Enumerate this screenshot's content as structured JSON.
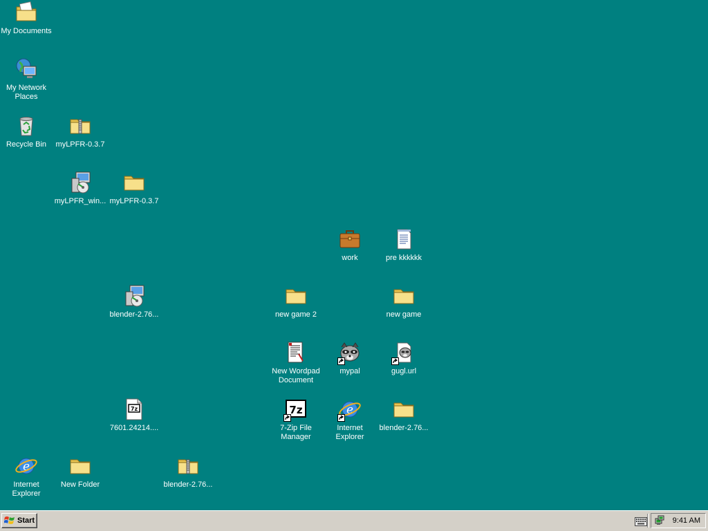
{
  "desktop": {
    "background": "#008080",
    "icons": [
      {
        "label": "My Documents",
        "icon": "my-documents-icon"
      },
      {
        "label": "My Network Places",
        "icon": "network-places-icon"
      },
      {
        "label": "Recycle Bin",
        "icon": "recycle-bin-icon"
      },
      {
        "label": "myLPFR-0.3.7",
        "icon": "zip-folder-icon"
      },
      {
        "label": "myLPFR_win...",
        "icon": "installer-icon"
      },
      {
        "label": "myLPFR-0.3.7",
        "icon": "folder-icon"
      },
      {
        "label": "work",
        "icon": "briefcase-icon"
      },
      {
        "label": "pre kkkkkk",
        "icon": "text-document-icon"
      },
      {
        "label": "blender-2.76...",
        "icon": "installer-icon"
      },
      {
        "label": "new game 2",
        "icon": "folder-icon"
      },
      {
        "label": "new game",
        "icon": "folder-icon"
      },
      {
        "label": "New Wordpad Document",
        "icon": "wordpad-document-icon"
      },
      {
        "label": "mypal",
        "icon": "raccoon-shortcut-icon"
      },
      {
        "label": "gugl.url",
        "icon": "url-shortcut-icon"
      },
      {
        "label": "7601.24214....",
        "icon": "7z-archive-icon"
      },
      {
        "label": "7-Zip File Manager",
        "icon": "7zip-shortcut-icon"
      },
      {
        "label": "Internet Explorer",
        "icon": "ie-shortcut-icon"
      },
      {
        "label": "blender-2.76...",
        "icon": "folder-icon"
      },
      {
        "label": "Internet Explorer",
        "icon": "ie-icon"
      },
      {
        "label": "New Folder",
        "icon": "folder-icon"
      },
      {
        "label": "blender-2.76...",
        "icon": "zip-folder-icon"
      }
    ]
  },
  "taskbar": {
    "start_label": "Start",
    "clock": "9:41 AM"
  }
}
